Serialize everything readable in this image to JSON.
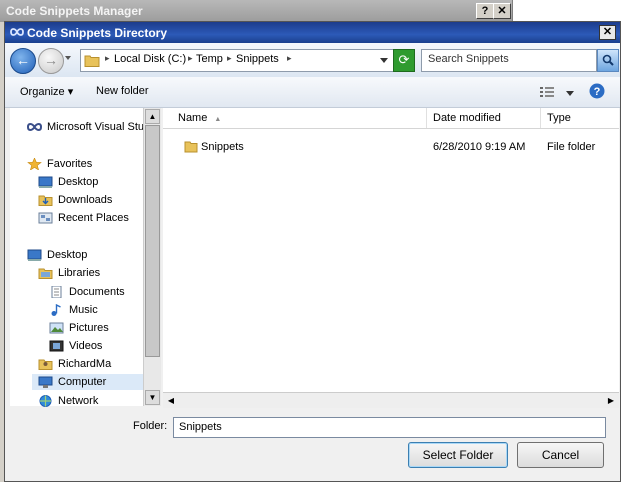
{
  "parent_window": {
    "title": "Code Snippets Manager",
    "help_label": "?",
    "close_label": "✕"
  },
  "dialog": {
    "title": "Code Snippets Directory",
    "close_label": "✕",
    "nav": {
      "back_glyph": "←",
      "forward_glyph": "→"
    },
    "address": {
      "root_label": "Local Disk (C:)",
      "crumbs": [
        "Temp",
        "Snippets"
      ],
      "separator": "▸"
    },
    "search": {
      "placeholder": "Search Snippets"
    },
    "toolbar": {
      "organize_label": "Organize ▾",
      "new_folder_label": "New folder"
    },
    "nav_pane": {
      "items": [
        {
          "label": "Microsoft Visual Studi",
          "icon": "visual-studio-icon"
        },
        {
          "label": "Favorites",
          "icon": "star-icon"
        },
        {
          "label": "Desktop",
          "icon": "desktop-icon"
        },
        {
          "label": "Downloads",
          "icon": "downloads-icon"
        },
        {
          "label": "Recent Places",
          "icon": "recent-places-icon"
        },
        {
          "label": "Desktop",
          "icon": "desktop-icon"
        },
        {
          "label": "Libraries",
          "icon": "libraries-icon"
        },
        {
          "label": "Documents",
          "icon": "documents-icon"
        },
        {
          "label": "Music",
          "icon": "music-icon"
        },
        {
          "label": "Pictures",
          "icon": "pictures-icon"
        },
        {
          "label": "Videos",
          "icon": "videos-icon"
        },
        {
          "label": "RichardMa",
          "icon": "user-icon"
        },
        {
          "label": "Computer",
          "icon": "computer-icon"
        },
        {
          "label": "Network",
          "icon": "network-icon"
        }
      ]
    },
    "file_list": {
      "columns": [
        "Name",
        "Date modified",
        "Type"
      ],
      "rows": [
        {
          "name": "Snippets",
          "date": "6/28/2010 9:19 AM",
          "type": "File folder"
        }
      ]
    },
    "footer": {
      "folder_label": "Folder:",
      "folder_value": "Snippets",
      "select_label": "Select Folder",
      "cancel_label": "Cancel"
    },
    "colors": {
      "title_bar": "#2c5ab8",
      "selected_item": "#dbe9f8",
      "folder": "#e8c25a"
    }
  }
}
